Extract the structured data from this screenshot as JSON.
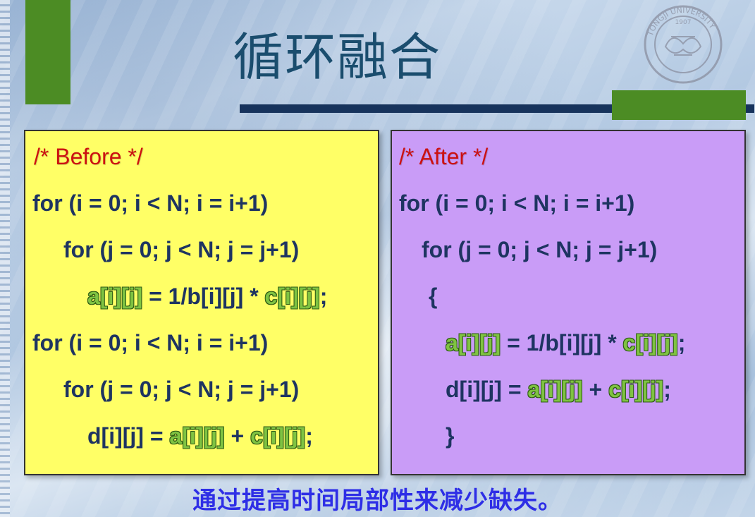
{
  "slide": {
    "title": "循环融合",
    "footer": "通过提高时间局部性来减少缺失。"
  },
  "seal": {
    "text": "TONGJI UNIVERSITY",
    "year": "1907"
  },
  "before": {
    "comment": "/* Before */",
    "line1": "for (i = 0; i < N; i = i+1)",
    "line2": "for (j = 0; j < N; j = j+1)",
    "line3_a": "a[i][j]",
    "line3_mid": " = 1/b[i][j] * ",
    "line3_c": "c[i][j]",
    "line3_end": ";",
    "line4": "for (i = 0; i < N; i = i+1)",
    "line5": "for (j = 0; j < N; j = j+1)",
    "line6_d": "d[i][j] = ",
    "line6_a": "a[i][j]",
    "line6_plus": " + ",
    "line6_c": "c[i][j]",
    "line6_end": ";"
  },
  "after": {
    "comment": "/* After */",
    "line1": "for (i = 0; i < N; i = i+1)",
    "line2": "for (j = 0; j < N; j = j+1)",
    "open_brace": "{",
    "line3_a": "a[i][j]",
    "line3_mid": " = 1/b[i][j] * ",
    "line3_c": "c[i][j]",
    "line3_end": ";",
    "line4_d": "d[i][j] = ",
    "line4_a": "a[i][j]",
    "line4_plus": " + ",
    "line4_c": "c[i][j]",
    "line4_end": ";",
    "close_brace": "}"
  },
  "colors": {
    "before_bg": "#ffff66",
    "after_bg": "#c99cf7",
    "accent_green": "#4c8c24",
    "title_color": "#1a4d6e",
    "footer_color": "#2e2ee6",
    "comment_color": "#cc1111"
  }
}
